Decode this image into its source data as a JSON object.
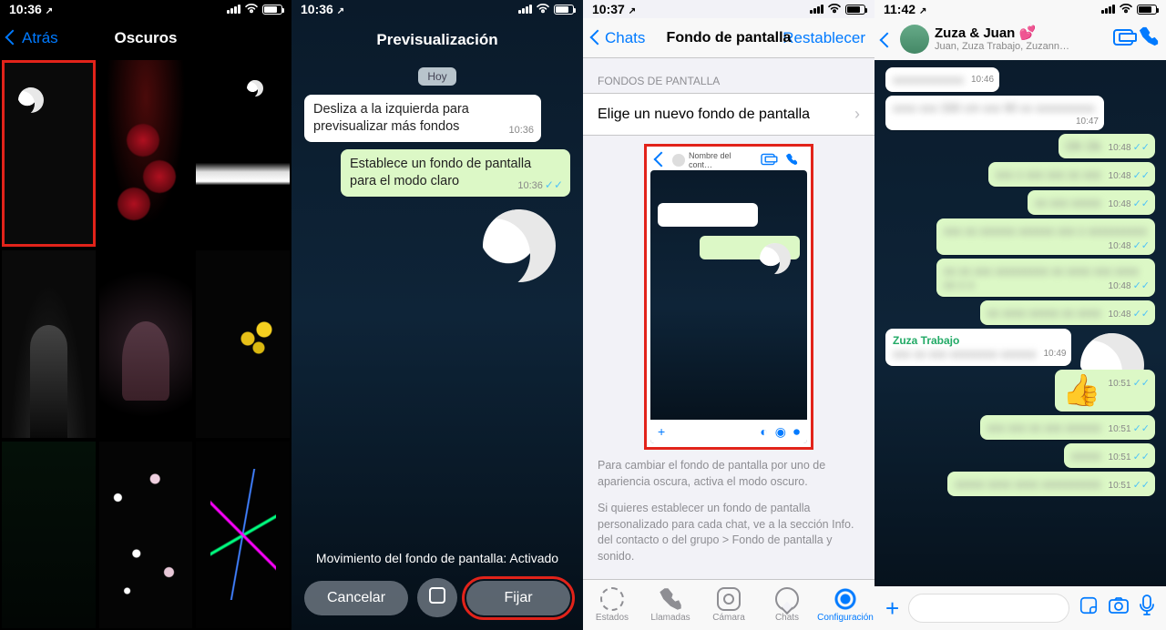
{
  "pane1": {
    "time": "10:36",
    "loc": "↗",
    "back": "Atrás",
    "title": "Oscuros"
  },
  "pane2": {
    "time": "10:36",
    "loc": "↗",
    "title": "Previsualización",
    "date": "Hoy",
    "msg_in": "Desliza a la izquierda para previsualizar más fondos",
    "msg_in_ts": "10:36",
    "msg_out": "Establece un fondo de pantalla para el modo claro",
    "msg_out_ts": "10:36",
    "motion": "Movimiento del fondo de pantalla: Activado",
    "cancel": "Cancelar",
    "set": "Fijar"
  },
  "pane3": {
    "time": "10:37",
    "loc": "↗",
    "back": "Chats",
    "title": "Fondo de pantalla",
    "reset": "Restablecer",
    "section": "FONDOS DE PANTALLA",
    "choose": "Elige un nuevo fondo de pantalla",
    "pv_contact": "Nombre del cont…",
    "desc1": "Para cambiar el fondo de pantalla por uno de apariencia oscura, activa el modo oscuro.",
    "desc2": "Si quieres establecer un fondo de pantalla personalizado para cada chat, ve a la sección Info. del contacto o del grupo > Fondo de pantalla y sonido.",
    "tabs": {
      "estados": "Estados",
      "llamadas": "Llamadas",
      "camara": "Cámara",
      "chats": "Chats",
      "config": "Configuración"
    }
  },
  "pane4": {
    "time": "11:42",
    "loc": "↗",
    "chat_name": "Zuza & Juan 💕",
    "chat_sub": "Juan, Zuza Trabajo, Zuzann…",
    "sender": "Zuza Trabajo",
    "m": [
      {
        "dir": "in",
        "txt": "xxxxxxxxxxxx",
        "ts": "10:46"
      },
      {
        "dir": "in",
        "txt": "xxxx xxx 330 cm xxx 90 xx xxxxxxxxxx",
        "ts": "10:47"
      },
      {
        "dir": "out",
        "txt": "OK Ok",
        "ts": "10:48"
      },
      {
        "dir": "out",
        "txt": "xxx x xxx xxx xx xxx",
        "ts": "10:48"
      },
      {
        "dir": "out",
        "txt": "xx xxx xxxxx",
        "ts": "10:48"
      },
      {
        "dir": "out",
        "txt": "xxx xx xxxxxx xxxxxx xxx x xxxxxxxxxx",
        "ts": "10:48"
      },
      {
        "dir": "out",
        "txt": "xx xx xxx xxxxxxxxx xx xxxx xxx xxxx xx x x",
        "ts": "10:48"
      },
      {
        "dir": "out",
        "txt": "xx xxxx xxxxx xx xxxx",
        "ts": "10:48"
      },
      {
        "dir": "in",
        "txt": "xxx xx xxx xxxxxxxx xxxxxx",
        "ts": "10:49",
        "sender": true
      },
      {
        "dir": "out",
        "txt": "👍",
        "ts": "10:51",
        "emoji": true
      },
      {
        "dir": "out",
        "txt": "xxx xxx xx xxx xxxxxx",
        "ts": "10:51"
      },
      {
        "dir": "out",
        "txt": "xxxxx",
        "ts": "10:51"
      },
      {
        "dir": "out",
        "txt": "xxxxx xxxx xxxx xxxxxxxxxx",
        "ts": "10:51"
      }
    ]
  }
}
